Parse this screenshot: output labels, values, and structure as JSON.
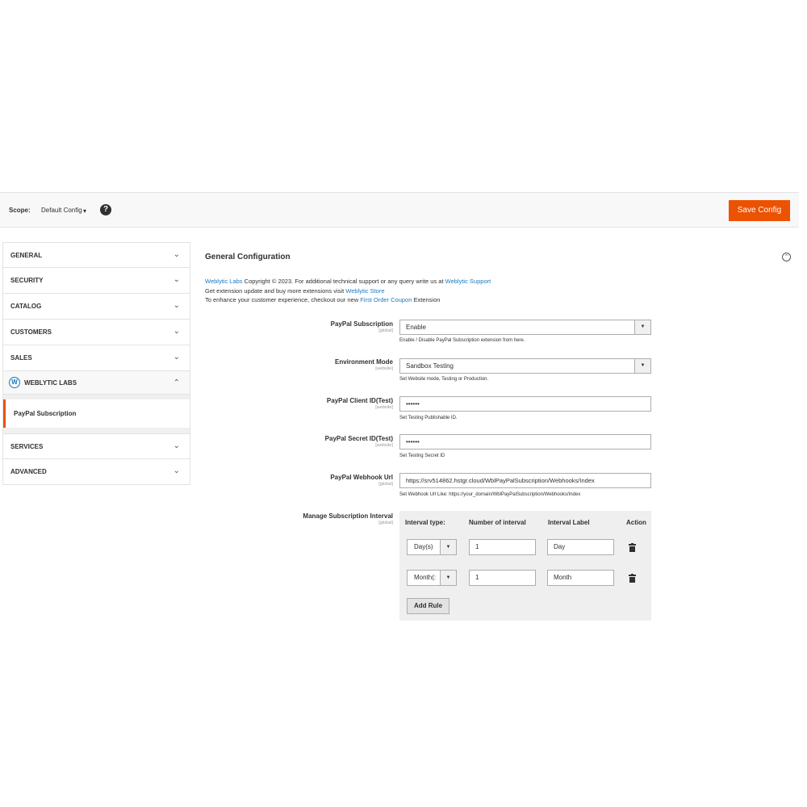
{
  "scope": {
    "label": "Scope:",
    "value": "Default Config",
    "caret": "▾",
    "help": "?"
  },
  "toolbar": {
    "save_label": "Save Config"
  },
  "sidebar": {
    "items": [
      {
        "label": "GENERAL",
        "chev": "⌄"
      },
      {
        "label": "SECURITY",
        "chev": "⌄"
      },
      {
        "label": "CATALOG",
        "chev": "⌄"
      },
      {
        "label": "CUSTOMERS",
        "chev": "⌄"
      },
      {
        "label": "SALES",
        "chev": "⌄"
      },
      {
        "label": "WEBLYTIC LABS",
        "chev": "⌃"
      }
    ],
    "sub_item": "PayPal Subscription",
    "after": [
      {
        "label": "SERVICES",
        "chev": "⌄"
      },
      {
        "label": "ADVANCED",
        "chev": "⌄"
      }
    ]
  },
  "main": {
    "title": "General Configuration",
    "intro": {
      "l1_link1": "Weblytic Labs",
      "l1_text": " Copyright © 2023. For additional technical support or any query write us at ",
      "l1_link2": "Weblytic Support",
      "l2_text": "Get extension update and buy more extensions visit ",
      "l2_link": "Weblytic Store",
      "l3_text": "To enhance your customer experience, checkout our new ",
      "l3_link": "First Order Coupon",
      "l3_tail": " Extension"
    },
    "fields": {
      "subscription": {
        "label": "PayPal Subscription",
        "scope": "[global]",
        "value": "Enable",
        "hint": "Enable / Disable PayPal Subscription extension from here."
      },
      "environment": {
        "label": "Environment Mode",
        "scope": "[website]",
        "value": "Sandbox Testing",
        "hint": "Set Website mode, Testing or Production."
      },
      "client_id": {
        "label": "PayPal Client ID(Test)",
        "scope": "[website]",
        "value": "••••••",
        "hint": "Set Testing Publishable ID."
      },
      "secret_id": {
        "label": "PayPal Secret ID(Test)",
        "scope": "[website]",
        "value": "••••••",
        "hint": "Set Testing Secret ID"
      },
      "webhook": {
        "label": "PayPal Webhook Url",
        "scope": "[global]",
        "value": "https://srv514862.hstgr.cloud/WblPayPalSubscription/Webhooks/Index",
        "hint": "Set Webhook Url Like: https://your_domain/WblPayPalSubscription/Webhooks/Index"
      },
      "interval": {
        "label": "Manage Subscription Interval",
        "scope": "[global]"
      }
    },
    "interval_table": {
      "headers": [
        "Interval type:",
        "Number of interval",
        "Interval Label",
        "Action"
      ],
      "rows": [
        {
          "type": "Day(s)",
          "number": "1",
          "label": "Day"
        },
        {
          "type": "Month(:",
          "number": "1",
          "label": "Month"
        }
      ],
      "add_label": "Add Rule"
    }
  }
}
